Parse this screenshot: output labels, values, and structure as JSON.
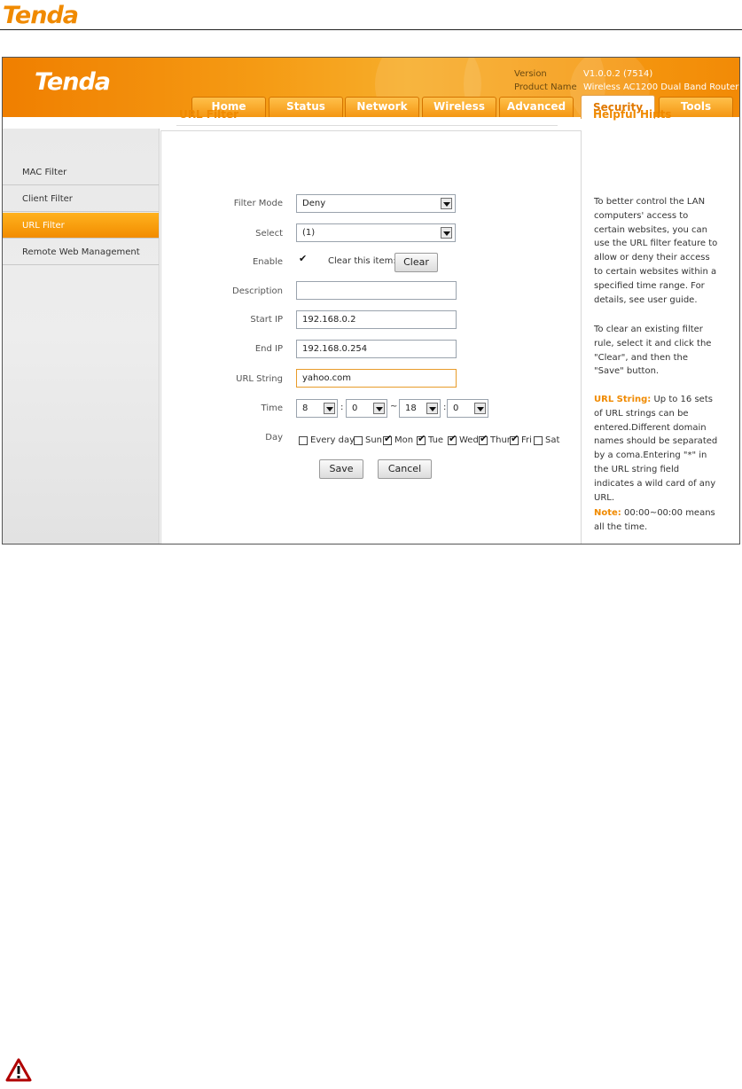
{
  "doc": {
    "logo": "Tenda"
  },
  "router": {
    "logo": "Tenda",
    "version_label": "Version",
    "version_value": "V1.0.0.2 (7514)",
    "product_label": "Product Name",
    "product_value": "Wireless AC1200 Dual Band Router"
  },
  "nav": {
    "tabs": [
      "Home",
      "Status",
      "Network",
      "Wireless",
      "Advanced",
      "Security",
      "Tools"
    ],
    "active": "Security"
  },
  "sidebar": {
    "items": [
      "MAC Filter",
      "Client Filter",
      "URL Filter",
      "Remote Web Management"
    ],
    "active": "URL Filter"
  },
  "form": {
    "title": "URL Filter",
    "filter_mode_label": "Filter Mode",
    "filter_mode_value": "Deny",
    "select_label": "Select",
    "select_value": "(1)",
    "enable_label": "Enable",
    "enable_checked": true,
    "clear_item_label": "Clear this item:",
    "clear_button": "Clear",
    "description_label": "Description",
    "description_value": "",
    "start_ip_label": "Start IP",
    "start_ip_value": "192.168.0.2",
    "end_ip_label": "End IP",
    "end_ip_value": "192.168.0.254",
    "url_string_label": "URL String",
    "url_string_value": "yahoo.com",
    "time_label": "Time",
    "time_start_hour": "8",
    "time_start_min": "0",
    "time_sep": ":",
    "time_range_sep": "~",
    "time_end_hour": "18",
    "time_end_min": "0",
    "day_label": "Day",
    "days": [
      {
        "label": "Every day",
        "checked": false
      },
      {
        "label": "Sun",
        "checked": false
      },
      {
        "label": "Mon",
        "checked": true
      },
      {
        "label": "Tue",
        "checked": true
      },
      {
        "label": "Wed",
        "checked": true
      },
      {
        "label": "Thur",
        "checked": true
      },
      {
        "label": "Fri",
        "checked": true
      },
      {
        "label": "Sat",
        "checked": false
      }
    ],
    "save_button": "Save",
    "cancel_button": "Cancel"
  },
  "hints": {
    "title": "Helpful Hints",
    "p1": "To better control the LAN computers' access to certain websites, you can use the URL filter feature to allow or deny their access to certain websites within a specified time range. For details, see user guide.",
    "p2": "To clear an existing filter rule, select it and click the \"Clear\", and then the \"Save\" button.",
    "p3_key": "URL String:",
    "p3": "Up to 16 sets of URL strings can be entered.Different domain names should be separated by a coma.Entering \"*\" in the URL string field indicates a wild card of any URL.",
    "p4_key": "Note:",
    "p4": "00:00~00:00 means all the time."
  },
  "colors": {
    "accent": "#f08a00",
    "active_tab_text": "#e07800"
  },
  "icons": {
    "warning": "warning-triangle-icon",
    "dropdown": "chevron-down-icon",
    "check": "checkmark-icon"
  }
}
